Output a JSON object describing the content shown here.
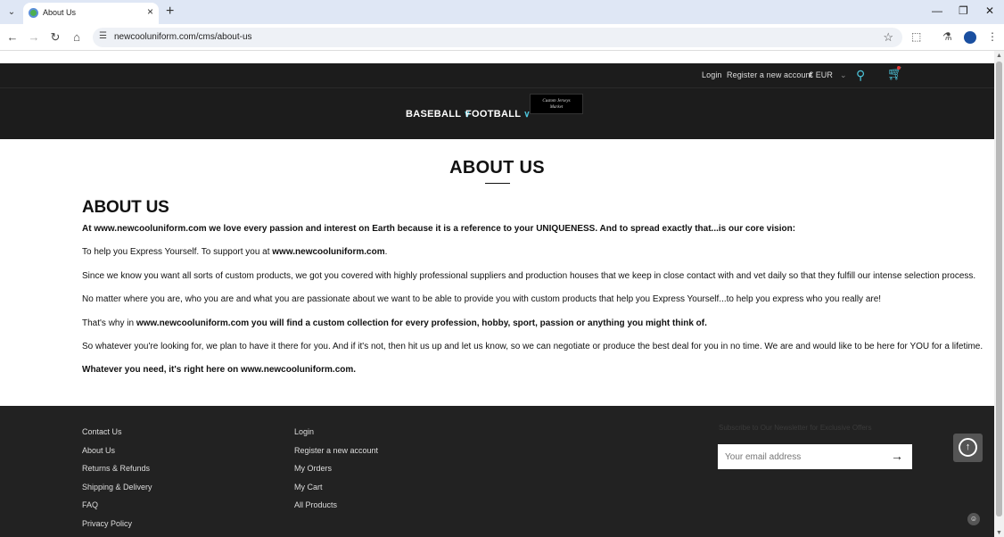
{
  "browser": {
    "tab_title": "About Us",
    "url": "newcooluniform.com/cms/about-us"
  },
  "topbar": {
    "login": "Login",
    "register": "Register a new account",
    "currency": "€ EUR"
  },
  "nav": {
    "items": [
      "BASEBALL",
      "FOOTBALL"
    ],
    "logo_line1": "Custom Jerseys",
    "logo_line2": "Market"
  },
  "main": {
    "page_title": "ABOUT US",
    "heading": "ABOUT US",
    "p1": "At www.newcooluniform.com we love every passion and interest on Earth because it is a reference to your UNIQUENESS. And to spread exactly that...is our core vision:",
    "p2_a": "To help you Express Yourself. To support you at ",
    "p2_b": "www.newcooluniform.com",
    "p2_c": ".",
    "p3": "Since we know you want all sorts of custom products, we got you covered with highly professional suppliers and production houses that we keep in close contact with and vet daily so that they fulfill our intense selection process.",
    "p4": "No matter where you are, who you are and what you are passionate about we want to be able to provide you with custom products that help you Express Yourself...to help you express who you really are!",
    "p5_a": "That's why in ",
    "p5_b": "www.newcooluniform.com you will find a custom collection for every profession, hobby, sport, passion or anything you might think of.",
    "p6": "So whatever you're looking for, we plan to have it there for you. And if it's not, then hit us up and let us know, so we can negotiate or produce the best deal for you in no time. We are and would like to be here for YOU for a lifetime.",
    "p7": "Whatever you need, it's right here on www.newcooluniform.com."
  },
  "footer": {
    "col1": [
      "Contact Us",
      "About Us",
      "Returns & Refunds",
      "Shipping & Delivery",
      "FAQ",
      "Privacy Policy"
    ],
    "col2": [
      "Login",
      "Register a new account",
      "My Orders",
      "My Cart",
      "All Products"
    ],
    "newsletter_title": "Subscribe to Our Newsletter for Exclusive Offers",
    "email_placeholder": "Your email address"
  }
}
